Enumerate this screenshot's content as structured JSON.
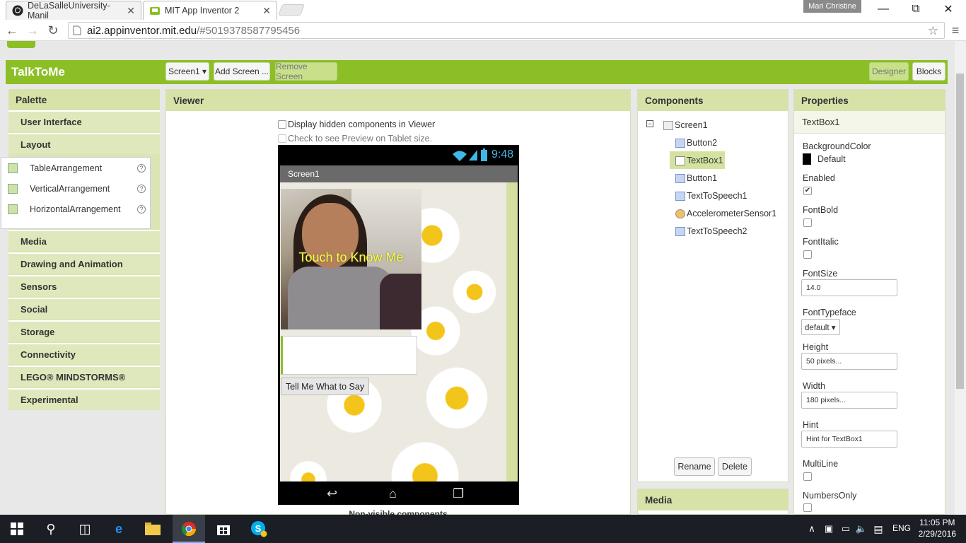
{
  "browser": {
    "tabs": [
      {
        "title": "DeLaSalleUniversity-Manil",
        "close": "✕"
      },
      {
        "title": "MIT App Inventor 2",
        "close": "✕"
      }
    ],
    "user": "Mari Christine",
    "url_host": "ai2.appinventor.mit.edu",
    "url_path": "/#5019378587795456"
  },
  "app": {
    "project_name": "TalkToMe",
    "screen_select": "Screen1 ▾",
    "add_screen": "Add Screen ...",
    "remove_screen": "Remove Screen",
    "designer": "Designer",
    "blocks": "Blocks"
  },
  "palette": {
    "title": "Palette",
    "categories_top": [
      "User Interface",
      "Layout"
    ],
    "layout_items": [
      "TableArrangement",
      "VerticalArrangement",
      "HorizontalArrangement"
    ],
    "help": "?",
    "categories_bottom": [
      "Media",
      "Drawing and Animation",
      "Sensors",
      "Social",
      "Storage",
      "Connectivity",
      "LEGO® MINDSTORMS®",
      "Experimental"
    ]
  },
  "viewer": {
    "title": "Viewer",
    "hidden_label": "Display hidden components in Viewer",
    "tablet_label": "Check to see Preview on Tablet size.",
    "time": "9:48",
    "screen_title": "Screen1",
    "photo_text": "Touch to Know Me",
    "button_text": "Tell Me What to Say",
    "nonvisible": "Non-visible components"
  },
  "components": {
    "title": "Components",
    "items": [
      "Screen1",
      "Button2",
      "TextBox1",
      "Button1",
      "TextToSpeech1",
      "AccelerometerSensor1",
      "TextToSpeech2"
    ],
    "rename": "Rename",
    "delete": "Delete",
    "media_title": "Media"
  },
  "properties": {
    "title": "Properties",
    "selected": "TextBox1",
    "background_color_label": "BackgroundColor",
    "background_color_value": "Default",
    "enabled_label": "Enabled",
    "enabled": true,
    "fontbold_label": "FontBold",
    "fontitalic_label": "FontItalic",
    "fontsize_label": "FontSize",
    "fontsize_value": "14.0",
    "fonttypeface_label": "FontTypeface",
    "fonttypeface_value": "default ▾",
    "height_label": "Height",
    "height_value": "50 pixels...",
    "width_label": "Width",
    "width_value": "180 pixels...",
    "hint_label": "Hint",
    "hint_value": "Hint for TextBox1",
    "multiline_label": "MultiLine",
    "numbersonly_label": "NumbersOnly"
  },
  "taskbar": {
    "language": "ENG",
    "time": "11:05 PM",
    "date": "2/29/2016"
  },
  "colors": {
    "accent_green": "#8cbf26",
    "panel_header": "#d6e2a8"
  }
}
